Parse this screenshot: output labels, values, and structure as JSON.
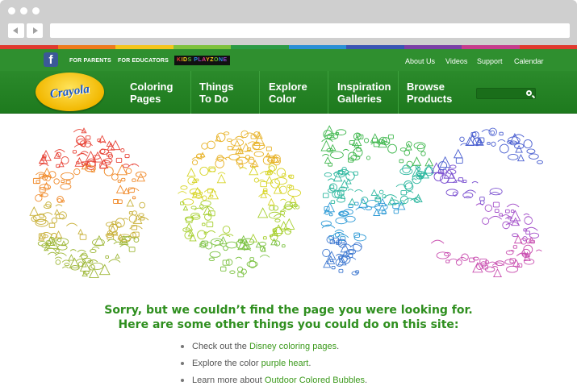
{
  "header": {
    "top_links": [
      "FOR PARENTS",
      "FOR EDUCATORS"
    ],
    "kids_badge": [
      "KIDS",
      "PLAYZONE"
    ],
    "kids_colors": [
      "#e63b2e",
      "#f2a21b",
      "#f3d21b",
      "#5cb82f",
      "#2e8ae6",
      "#8e44c9",
      "#e63b8e",
      "#f2a21b",
      "#f3d21b",
      "#5cb82f",
      "#2e8ae6",
      "#8e44c9",
      "#e63b2e"
    ],
    "right_links": [
      "About Us",
      "Videos",
      "Support",
      "Calendar"
    ],
    "logo_text": "Crayola",
    "nav": [
      {
        "line1": "Coloring",
        "line2": "Pages"
      },
      {
        "line1": "Things",
        "line2": "To Do"
      },
      {
        "line1": "Explore",
        "line2": "Color"
      },
      {
        "line1": "Inspiration",
        "line2": "Galleries"
      },
      {
        "line1": "Browse",
        "line2": "Products"
      }
    ],
    "search_placeholder": ""
  },
  "colors": {
    "stripe": [
      "#e03a2f",
      "#ef7a1c",
      "#f4c51c",
      "#7fc23d",
      "#2c9a45",
      "#2a8fd6",
      "#3954b4",
      "#7b3fa6",
      "#c63c8c",
      "#e03a2f"
    ],
    "accent_green": "#2f8f1f",
    "link_green": "#3c9a1c",
    "nav_green": "#2b8a2b"
  },
  "illustration": {
    "letters": [
      "O",
      "O",
      "P",
      "S"
    ],
    "letter_colors": [
      [
        "#e8463a",
        "#f08a2a",
        "#c9b13a",
        "#9fb83a"
      ],
      [
        "#e8b32a",
        "#d8d52a",
        "#a6cf2e",
        "#7cc242"
      ],
      [
        "#41b84f",
        "#2fb8a0",
        "#2f9bd6",
        "#3e78d0"
      ],
      [
        "#4a5fd0",
        "#7a4fd0",
        "#a34fc9",
        "#c94fb0"
      ]
    ]
  },
  "message": {
    "line1": "Sorry, but we couldn’t find the page you were looking for.",
    "line2": "Here are some other things you could do on this site:"
  },
  "suggestions": [
    {
      "prefix": "Check out the ",
      "link": "Disney coloring pages",
      "suffix": "."
    },
    {
      "prefix": "Explore the color ",
      "link": "purple heart",
      "suffix": "."
    },
    {
      "prefix": "Learn more about ",
      "link": "Outdoor Colored Bubbles",
      "suffix": "."
    }
  ]
}
